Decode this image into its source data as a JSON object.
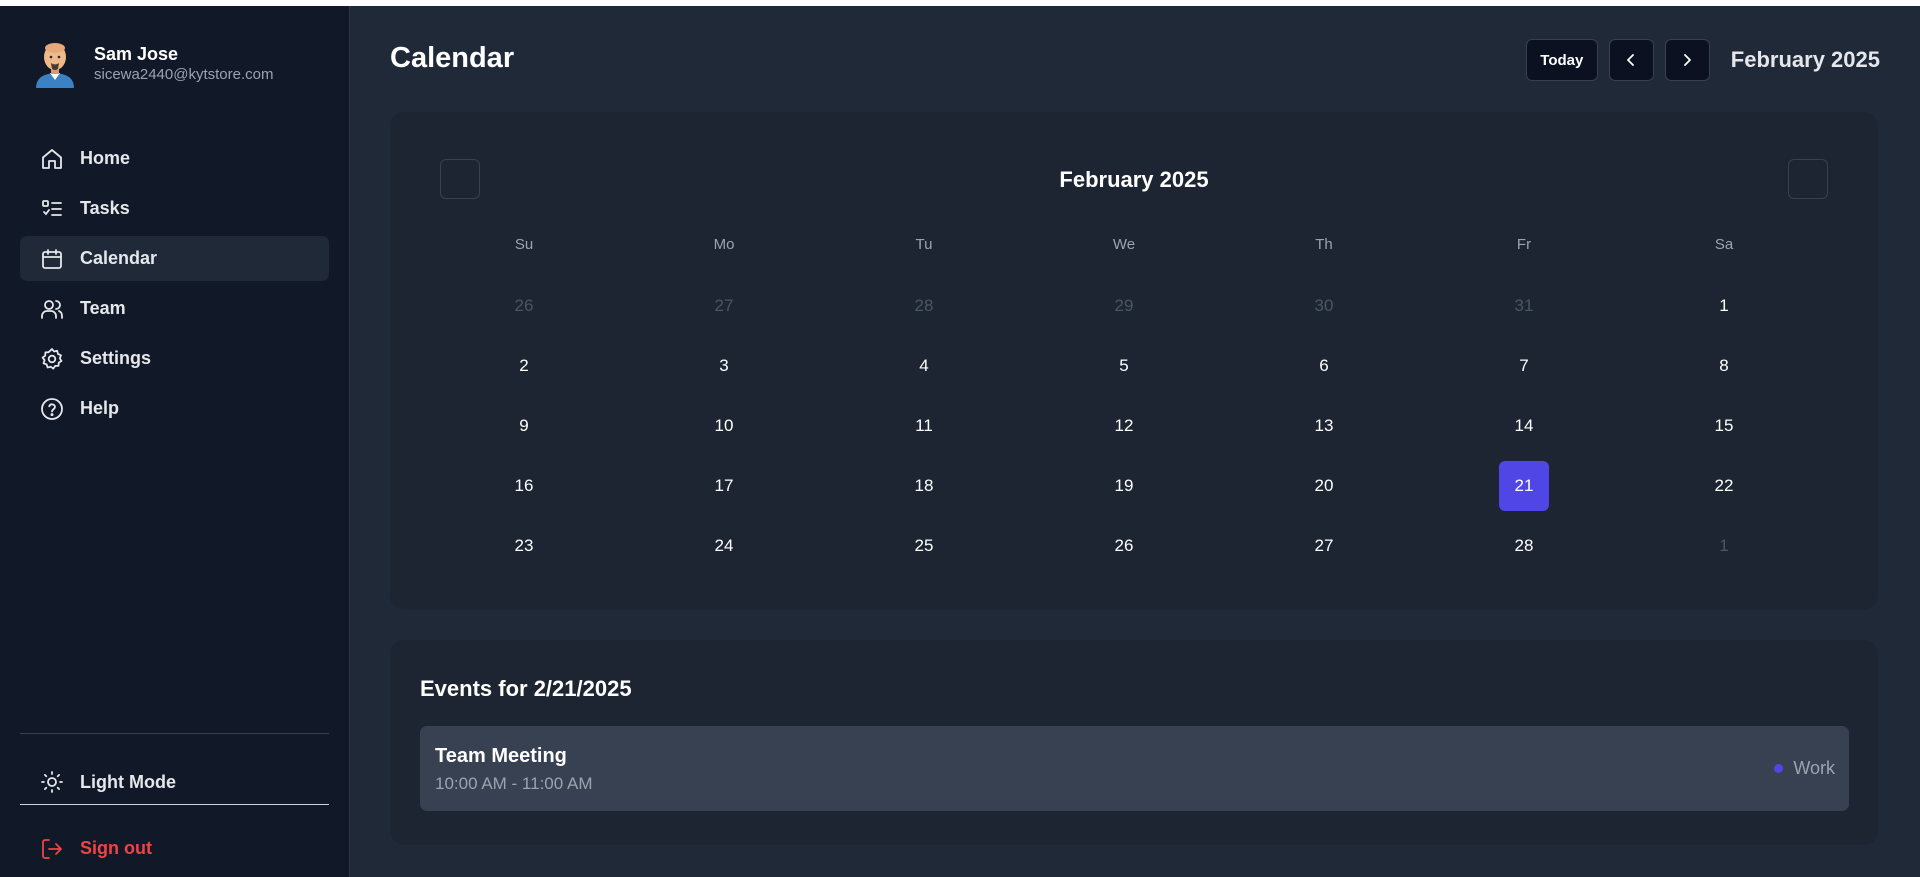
{
  "user": {
    "name": "Sam Jose",
    "email": "sicewa2440@kytstore.com"
  },
  "nav": [
    {
      "label": "Home",
      "icon": "home-icon",
      "active": false
    },
    {
      "label": "Tasks",
      "icon": "tasks-icon",
      "active": false
    },
    {
      "label": "Calendar",
      "icon": "calendar-icon",
      "active": true
    },
    {
      "label": "Team",
      "icon": "team-icon",
      "active": false
    },
    {
      "label": "Settings",
      "icon": "gear-icon",
      "active": false
    },
    {
      "label": "Help",
      "icon": "help-icon",
      "active": false
    }
  ],
  "footer": {
    "light_mode": "Light Mode",
    "sign_out": "Sign out"
  },
  "header": {
    "title": "Calendar",
    "today": "Today",
    "month": "February 2025"
  },
  "calendar": {
    "month": "February 2025",
    "weekdays": [
      "Su",
      "Mo",
      "Tu",
      "We",
      "Th",
      "Fr",
      "Sa"
    ],
    "days": [
      {
        "label": "26",
        "muted": true
      },
      {
        "label": "27",
        "muted": true
      },
      {
        "label": "28",
        "muted": true
      },
      {
        "label": "29",
        "muted": true
      },
      {
        "label": "30",
        "muted": true
      },
      {
        "label": "31",
        "muted": true
      },
      {
        "label": "1",
        "muted": false
      },
      {
        "label": "2"
      },
      {
        "label": "3"
      },
      {
        "label": "4"
      },
      {
        "label": "5"
      },
      {
        "label": "6"
      },
      {
        "label": "7"
      },
      {
        "label": "8"
      },
      {
        "label": "9"
      },
      {
        "label": "10"
      },
      {
        "label": "11"
      },
      {
        "label": "12"
      },
      {
        "label": "13"
      },
      {
        "label": "14"
      },
      {
        "label": "15"
      },
      {
        "label": "16"
      },
      {
        "label": "17"
      },
      {
        "label": "18"
      },
      {
        "label": "19"
      },
      {
        "label": "20"
      },
      {
        "label": "21",
        "selected": true
      },
      {
        "label": "22"
      },
      {
        "label": "23"
      },
      {
        "label": "24"
      },
      {
        "label": "25"
      },
      {
        "label": "26"
      },
      {
        "label": "27"
      },
      {
        "label": "28"
      },
      {
        "label": "1",
        "muted": true
      }
    ],
    "selected_color": "#4f46e5"
  },
  "events": {
    "title": "Events for 2/21/2025",
    "items": [
      {
        "title": "Team Meeting",
        "time": "10:00 AM - 11:00 AM",
        "category": "Work",
        "color": "#4f46e5"
      }
    ]
  }
}
